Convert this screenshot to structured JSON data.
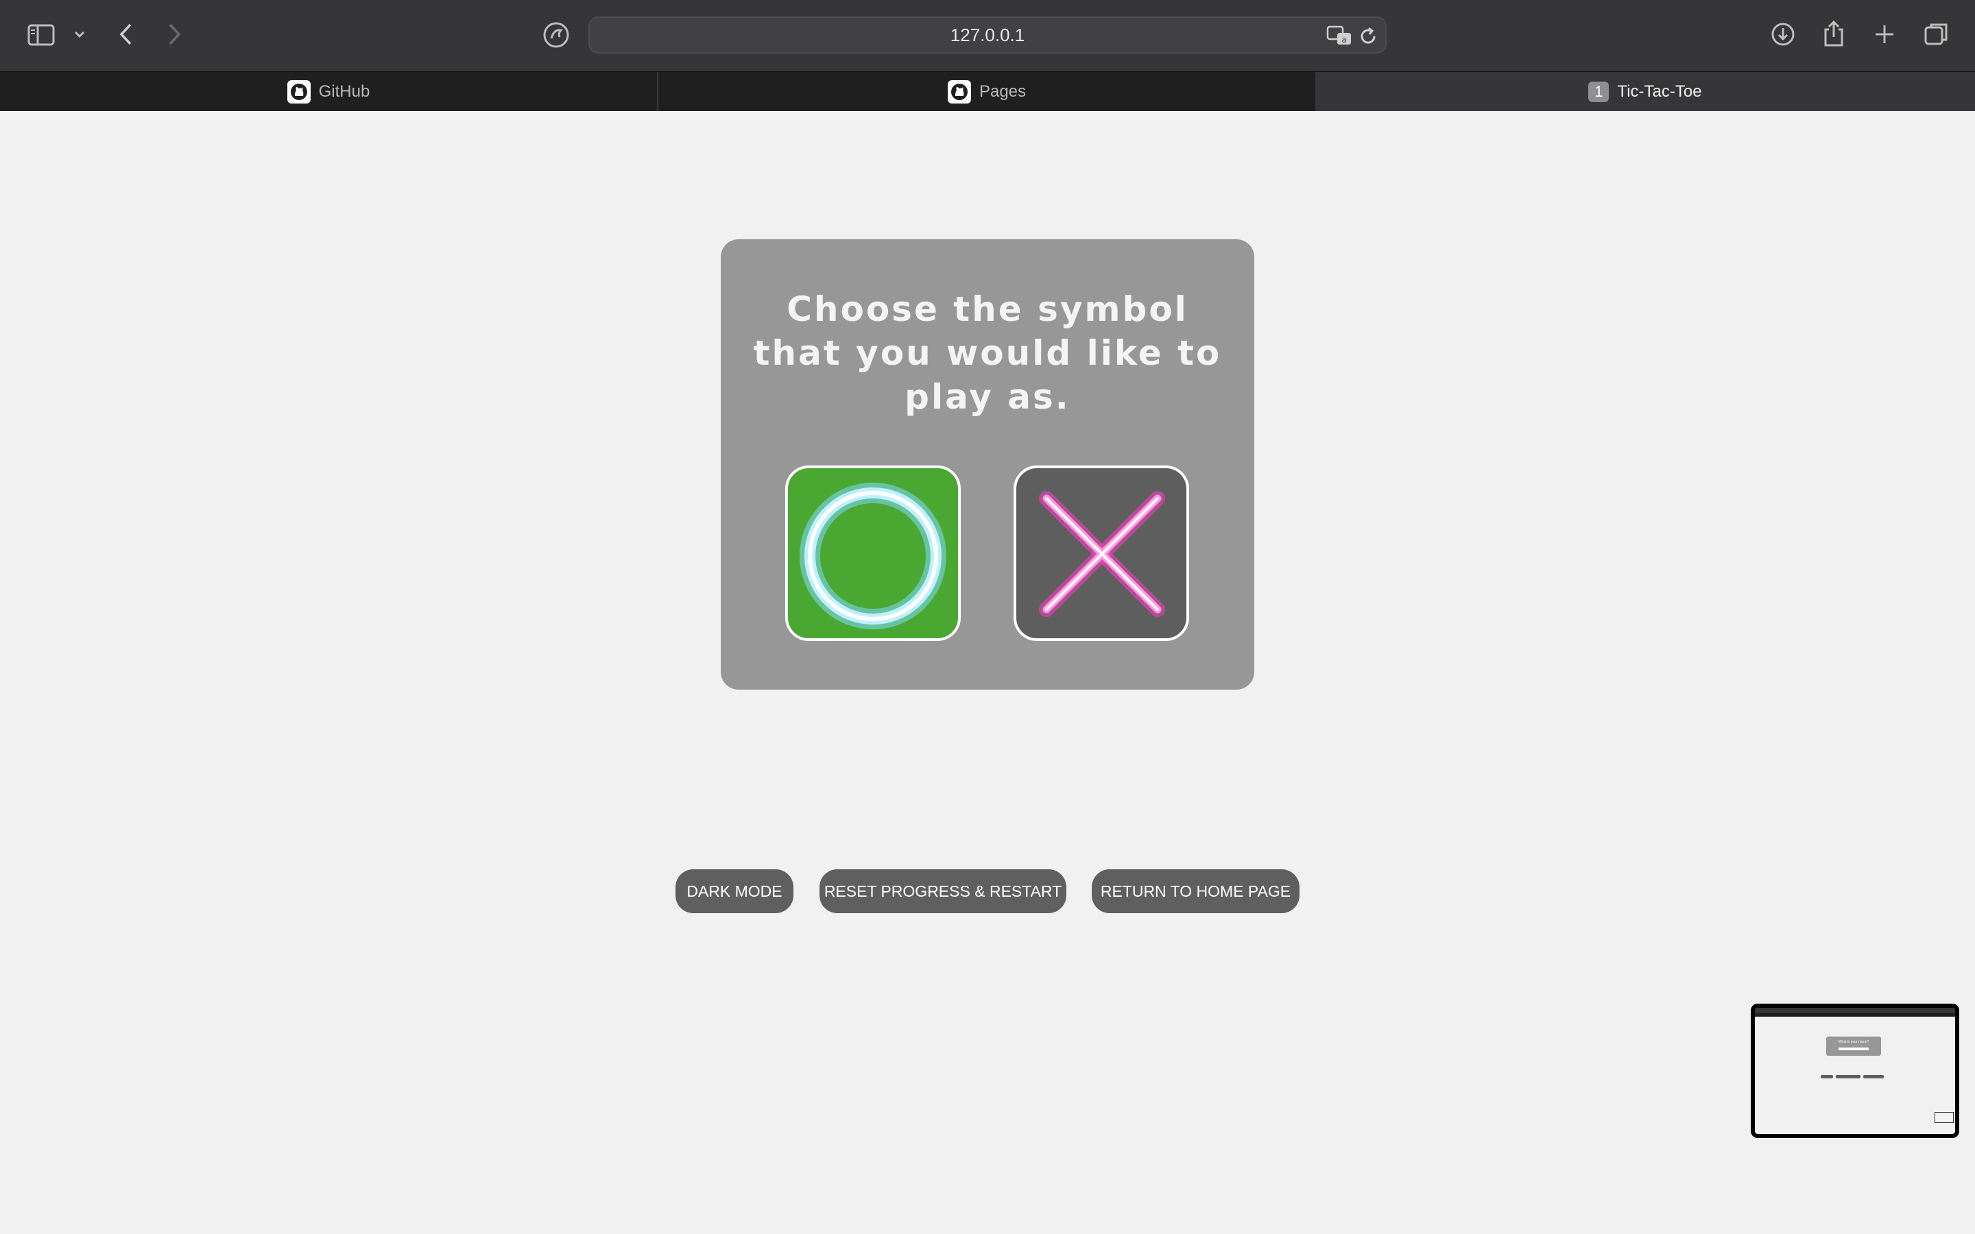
{
  "browser": {
    "url": "127.0.0.1",
    "tabs": [
      {
        "label": "GitHub",
        "icon": "github-icon",
        "active": false
      },
      {
        "label": "Pages",
        "icon": "github-icon",
        "active": false
      },
      {
        "label": "Tic-Tac-Toe",
        "badge": "1",
        "active": true
      }
    ]
  },
  "dialog": {
    "title": "Choose the symbol that you would like to play as.",
    "choices": [
      {
        "symbol": "O",
        "icon": "circle-o-icon",
        "selected": true,
        "bg_color": "#4aa832",
        "glow_color": "#9ce6ff"
      },
      {
        "symbol": "X",
        "icon": "cross-x-icon",
        "selected": false,
        "bg_color": "#5e5e5e",
        "glow_color": "#ff6ad5"
      }
    ]
  },
  "controls": {
    "dark_mode": "DARK MODE",
    "reset": "RESET PROGRESS & RESTART",
    "home": "RETURN TO HOME PAGE"
  },
  "preview": {
    "dialog_text": "What is your name?"
  }
}
